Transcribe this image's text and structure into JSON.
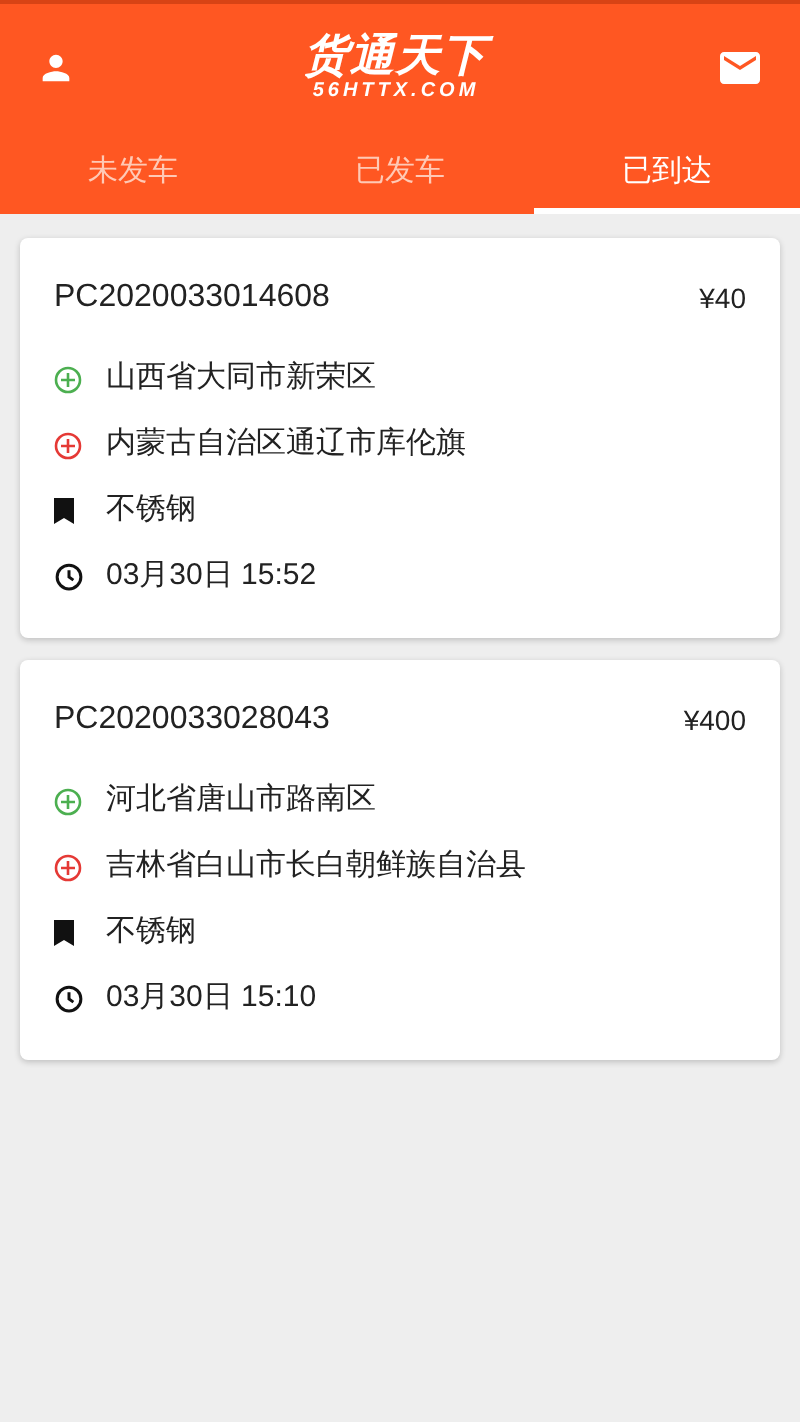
{
  "header": {
    "logo_title": "货通天下",
    "logo_subtitle": "56HTTX.COM"
  },
  "tabs": [
    {
      "label": "未发车",
      "selected": false
    },
    {
      "label": "已发车",
      "selected": false
    },
    {
      "label": "已到达",
      "selected": true
    }
  ],
  "orders": [
    {
      "number": "PC2020033014608",
      "price": "¥40",
      "rows": [
        {
          "kind": "origin",
          "text": "山西省大同市新荣区"
        },
        {
          "kind": "destination",
          "text": "内蒙古自治区通辽市库伦旗"
        },
        {
          "kind": "cargo",
          "text": "不锈钢"
        },
        {
          "kind": "time",
          "text": "03月30日 15:52"
        }
      ]
    },
    {
      "number": "PC2020033028043",
      "price": "¥400",
      "rows": [
        {
          "kind": "origin",
          "text": "河北省唐山市路南区"
        },
        {
          "kind": "destination",
          "text": "吉林省白山市长白朝鲜族自治县"
        },
        {
          "kind": "cargo",
          "text": "不锈钢"
        },
        {
          "kind": "time",
          "text": "03月30日 15:10"
        }
      ]
    }
  ]
}
